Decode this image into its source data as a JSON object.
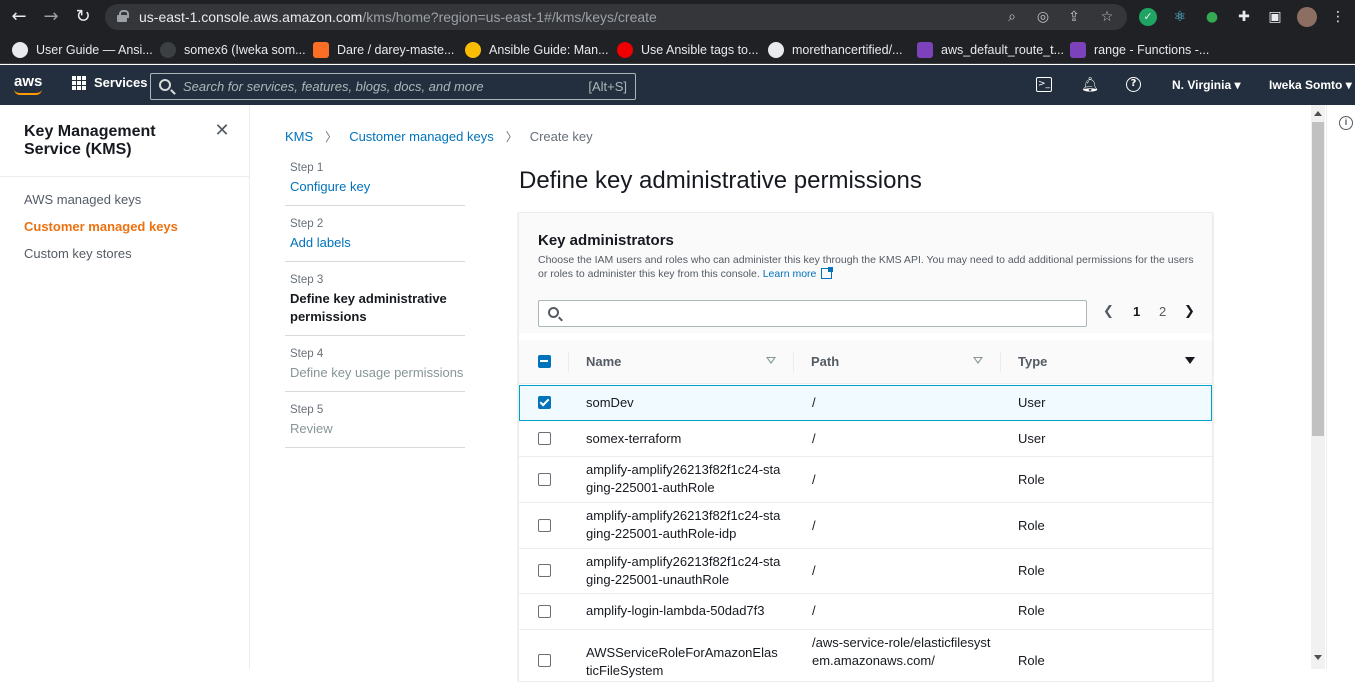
{
  "browser": {
    "url_host": "us-east-1.console.aws.amazon.com",
    "url_path": "/kms/home?region=us-east-1#/kms/keys/create",
    "bookmarks": [
      {
        "label": "User Guide — Ansi...",
        "color": "#e8eaed"
      },
      {
        "label": "somex6 (Iweka som...",
        "color": "#3c4043"
      },
      {
        "label": "Dare / darey-maste...",
        "color": "#fc6d26"
      },
      {
        "label": "Ansible Guide: Man...",
        "color": "#fbbc04"
      },
      {
        "label": "Use Ansible tags to...",
        "color": "#ee0000"
      },
      {
        "label": "morethancertified/...",
        "color": "#e8eaed"
      },
      {
        "label": "aws_default_route_t...",
        "color": "#7b42bc"
      },
      {
        "label": "range - Functions -...",
        "color": "#7b42bc"
      }
    ]
  },
  "aws_header": {
    "logo": "aws",
    "services": "Services",
    "search_placeholder": "Search for services, features, blogs, docs, and more",
    "search_shortcut": "[Alt+S]",
    "region": "N. Virginia",
    "user": "Iweka Somto"
  },
  "sidebar": {
    "title": "Key Management Service (KMS)",
    "items": [
      {
        "label": "AWS managed keys",
        "active": false
      },
      {
        "label": "Customer managed keys",
        "active": true
      },
      {
        "label": "Custom key stores",
        "active": false
      }
    ]
  },
  "breadcrumb": {
    "items": [
      "KMS",
      "Customer managed keys"
    ],
    "current": "Create key"
  },
  "steps": [
    {
      "num": "Step 1",
      "label": "Configure key",
      "state": "link"
    },
    {
      "num": "Step 2",
      "label": "Add labels",
      "state": "link"
    },
    {
      "num": "Step 3",
      "label": "Define key administrative permissions",
      "state": "current"
    },
    {
      "num": "Step 4",
      "label": "Define key usage permissions",
      "state": "disabled"
    },
    {
      "num": "Step 5",
      "label": "Review",
      "state": "disabled"
    }
  ],
  "page_title": "Define key administrative permissions",
  "panel": {
    "title": "Key administrators",
    "description": "Choose the IAM users and roles who can administer this key through the KMS API. You may need to add additional permissions for the users or roles to administer this key from this console.",
    "learn_more": "Learn more",
    "filter_value": "",
    "pages": [
      "1",
      "2"
    ],
    "current_page": "1",
    "columns": {
      "name": "Name",
      "path": "Path",
      "type": "Type"
    },
    "rows": [
      {
        "name": "somDev",
        "path": "/",
        "type": "User",
        "checked": true
      },
      {
        "name": "somex-terraform",
        "path": "/",
        "type": "User",
        "checked": false
      },
      {
        "name": "amplify-amplify26213f82f1c24-staging-225001-authRole",
        "path": "/",
        "type": "Role",
        "checked": false
      },
      {
        "name": "amplify-amplify26213f82f1c24-staging-225001-authRole-idp",
        "path": "/",
        "type": "Role",
        "checked": false
      },
      {
        "name": "amplify-amplify26213f82f1c24-staging-225001-unauthRole",
        "path": "/",
        "type": "Role",
        "checked": false
      },
      {
        "name": "amplify-login-lambda-50dad7f3",
        "path": "/",
        "type": "Role",
        "checked": false
      },
      {
        "name": "AWSServiceRoleForAmazonElasticFileSystem",
        "path": "/aws-service-role/elasticfilesystem.amazonaws.com/",
        "type": "Role",
        "checked": false
      }
    ]
  }
}
